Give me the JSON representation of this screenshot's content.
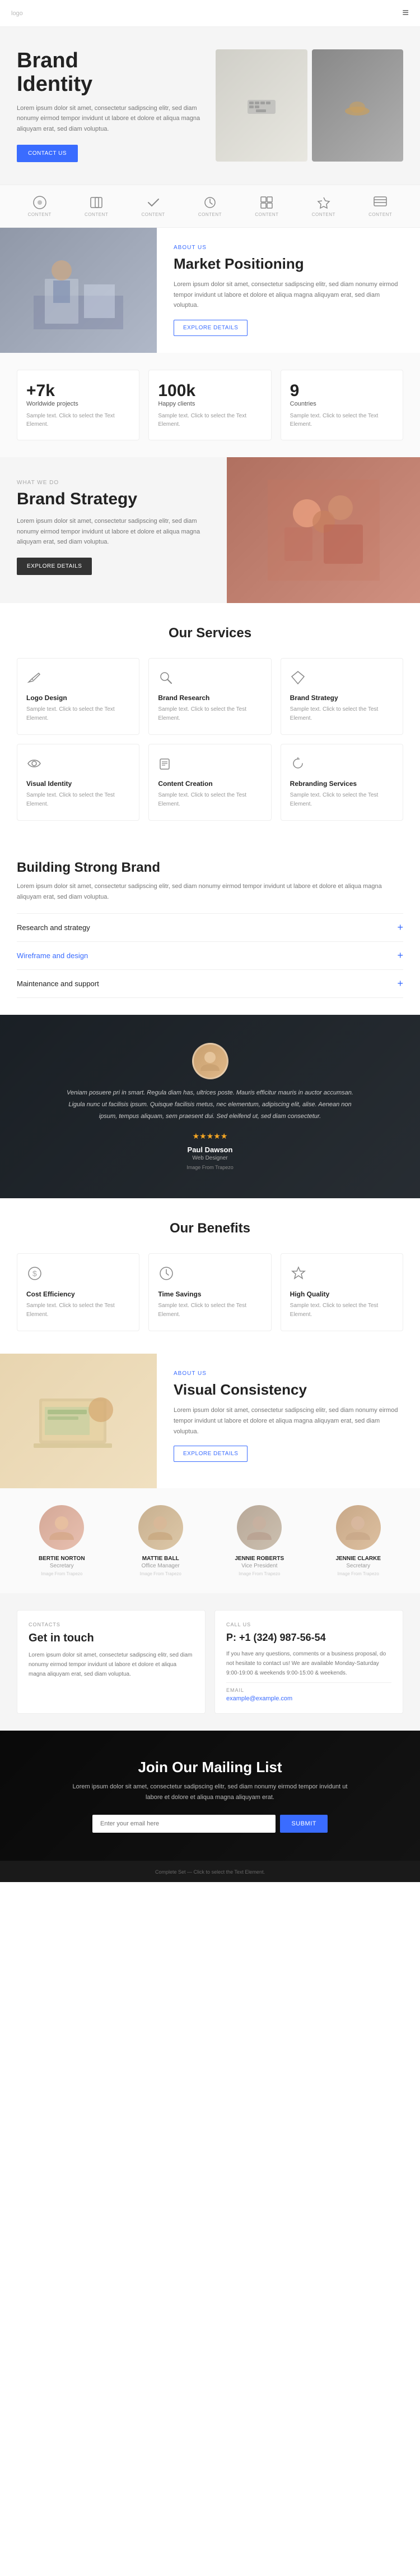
{
  "header": {
    "logo": "logo",
    "menu_icon": "≡"
  },
  "hero": {
    "title_line1": "Brand",
    "title_line2": "Identity",
    "description": "Lorem ipsum dolor sit amet, consectetur sadipscing elitr, sed diam nonumy eirmod tempor invidunt ut labore et dolore et aliqua magna aliquyam erat, sed diam voluptua.",
    "cta_label": "CONTACT US"
  },
  "icon_bar": {
    "items": [
      {
        "label": "CONTENT",
        "icon": "circle"
      },
      {
        "label": "CONTENT",
        "icon": "book"
      },
      {
        "label": "CONTENT",
        "icon": "check"
      },
      {
        "label": "CONTENT",
        "icon": "clock"
      },
      {
        "label": "CONTENT",
        "icon": "grid"
      },
      {
        "label": "CONTENT",
        "icon": "bolt"
      },
      {
        "label": "CONTENT",
        "icon": "layout"
      }
    ]
  },
  "about": {
    "label": "ABOUT US",
    "title": "Market Positioning",
    "description": "Lorem ipsum dolor sit amet, consectetur sadipscing elitr, sed diam nonumy eirmod tempor invidunt ut labore et dolore et aliqua magna aliquyam erat, sed diam voluptua.",
    "cta_label": "EXPLORE DETAILS"
  },
  "stats": [
    {
      "number": "+7k",
      "label": "Worldwide projects",
      "desc": "Sample text. Click to select the Text Element."
    },
    {
      "number": "100k",
      "label": "Happy clients",
      "desc": "Sample text. Click to select the Text Element."
    },
    {
      "number": "9",
      "label": "Countries",
      "desc": "Sample text. Click to select the Text Element."
    }
  ],
  "what_we_do": {
    "label": "WHAT WE DO",
    "title": "Brand Strategy",
    "description": "Lorem ipsum dolor sit amet, consectetur sadipscing elitr, sed diam nonumy eirmod tempor invidunt ut labore et dolore et aliqua magna aliquyam erat, sed diam voluptua.",
    "cta_label": "EXPLORE DETAILS"
  },
  "services": {
    "title": "Our Services",
    "items": [
      {
        "title": "Logo Design",
        "desc": "Sample text. Click to select the Text Element.",
        "icon": "pen"
      },
      {
        "title": "Brand Research",
        "desc": "Sample text. Click to select the Test Element.",
        "icon": "search"
      },
      {
        "title": "Brand Strategy",
        "desc": "Sample text. Click to select the Test Element.",
        "icon": "diamond"
      },
      {
        "title": "Visual Identity",
        "desc": "Sample text. Click to select the Test Element.",
        "icon": "eye"
      },
      {
        "title": "Content Creation",
        "desc": "Sample text. Click to select the Test Element.",
        "icon": "edit"
      },
      {
        "title": "Rebranding Services",
        "desc": "Sample text. Click to select the Test Element.",
        "icon": "refresh"
      }
    ]
  },
  "building": {
    "title": "Building Strong Brand",
    "description": "Lorem ipsum dolor sit amet, consectetur sadipscing elitr, sed diam nonumy eirmod tempor invidunt ut labore et dolore et aliqua magna aliquyam erat, sed diam voluptua.",
    "accordion": [
      {
        "title": "Research and strategy",
        "active": true
      },
      {
        "title": "Wireframe and design",
        "active": false
      },
      {
        "title": "Maintenance and support",
        "active": false
      }
    ]
  },
  "testimonial": {
    "quote": "Veniam posuere pri in smart. Regula diam has, ultrices poste. Mauris efficitur mauris in auctor accumsan. Ligula nunc ut facilisis ipsum. Quisque facilisis metus, nec elementum, adipiscing elit, alise. Aenean non ipsum, tempus aliquam, sem praesent dui. Sed eleifend ut, sed diam consectetur.",
    "name": "Paul Dawson",
    "role": "Web Designer",
    "company": "Image From Trapezo",
    "stars": "★★★★★"
  },
  "benefits": {
    "title": "Our Benefits",
    "items": [
      {
        "title": "Cost Efficiency",
        "desc": "Sample text. Click to select the Test Element.",
        "icon": "dollar"
      },
      {
        "title": "Time Savings",
        "desc": "Sample text. Click to select the Test Element.",
        "icon": "clock"
      },
      {
        "title": "High Quality",
        "desc": "Sample text. Click to select the Test Element.",
        "icon": "star"
      }
    ]
  },
  "visual": {
    "label": "ABOUT US",
    "title": "Visual Consistency",
    "description": "Lorem ipsum dolor sit amet, consectetur sadipscing elitr, sed diam nonumy eirmod tempor invidunt ut labore et dolore et aliqua magna aliquyam erat, sed diam voluptua.",
    "cta_label": "EXPLORE DETAILS"
  },
  "team": {
    "members": [
      {
        "name": "BERTIE NORTON",
        "role": "Secretary",
        "tag": "Image From Trapezo",
        "bg": "#d4a897"
      },
      {
        "name": "MATTIE BALL",
        "role": "Office Manager",
        "tag": "Image From Trapezo",
        "bg": "#c8b090"
      },
      {
        "name": "JENNIE ROBERTS",
        "role": "Vice President",
        "tag": "Image From Trapezo",
        "bg": "#b8a898"
      },
      {
        "name": "JENNIE CLARKE",
        "role": "Secretary",
        "tag": "Image From Trapezo",
        "bg": "#c8a888"
      }
    ]
  },
  "contact": {
    "section1": {
      "label": "CONTACTS",
      "title": "Get in touch",
      "description": "Lorem ipsum dolor sit amet, consectetur sadipscing elitr, sed diam nonumy eirmod tempor invidunt ut labore et dolore et aliqua magna aliquyam erat, sed diam voluptua."
    },
    "section2": {
      "label": "CALL US",
      "phone": "P: +1 (324) 987-56-54",
      "description": "If you have any questions, comments or a business proposal, do not hesitate to contact us! We are available Monday-Saturday 9:00-19:00 & weekends 9:00-15:00 & weekends.",
      "email_label": "EMAIL",
      "email": "example@example.com"
    }
  },
  "mailing": {
    "title": "Join Our Mailing List",
    "description": "Lorem ipsum dolor sit amet, consectetur sadipscing elitr, sed diam nonumy eirmod tempor invidunt ut labore et dolore et aliqua magna aliquyam erat.",
    "placeholder": "Enter your email here",
    "submit_label": "SUBMIT"
  },
  "footer": {
    "copyright": "Complete Set — Click to select the Text Element."
  },
  "colors": {
    "primary": "#3a6cff",
    "dark": "#222",
    "light_bg": "#f5f5f5",
    "border": "#eee",
    "text_muted": "#777",
    "text_light": "#999"
  }
}
